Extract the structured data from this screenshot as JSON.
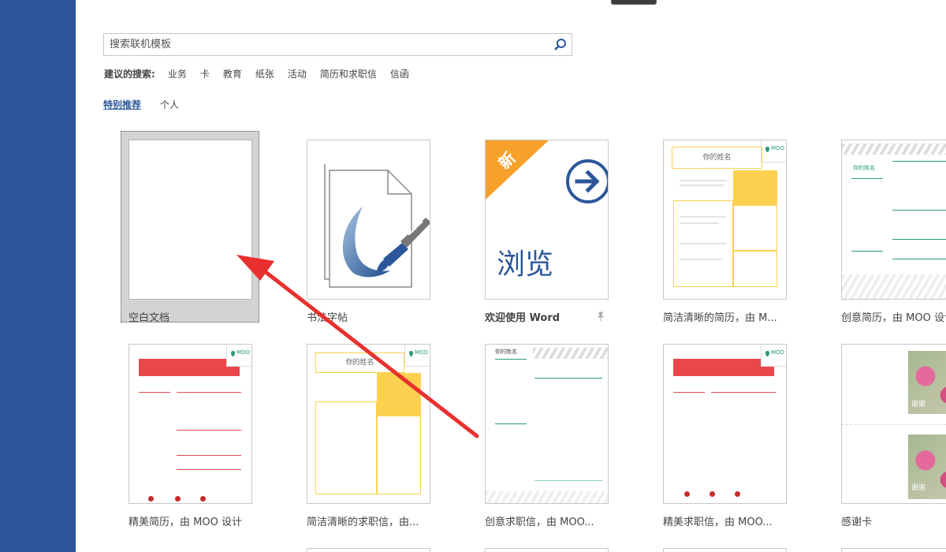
{
  "search": {
    "placeholder": "搜索联机模板"
  },
  "suggested": {
    "label": "建议的搜索:",
    "items": [
      "业务",
      "卡",
      "教育",
      "纸张",
      "活动",
      "简历和求职信",
      "信函"
    ]
  },
  "tabs": [
    {
      "label": "特别推荐",
      "active": true
    },
    {
      "label": "个人",
      "active": false
    }
  ],
  "templates": [
    {
      "label": "空白文档"
    },
    {
      "label": "书法字帖"
    },
    {
      "label": "欢迎使用 Word"
    },
    {
      "label": "简洁清晰的简历，由 M..."
    },
    {
      "label": "创意简历，由 MOO 设计"
    },
    {
      "label": "精美简历，由 MOO 设计"
    },
    {
      "label": "简洁清晰的求职信，由..."
    },
    {
      "label": "创意求职信，由 MOO..."
    },
    {
      "label": "精美求职信，由 MOO..."
    },
    {
      "label": "感谢卡"
    }
  ],
  "browse_tile": {
    "badge": "新",
    "text": "浏览"
  },
  "moo_badge": "MOO",
  "resume_name": "你的姓名",
  "thank_you_text": "谢谢",
  "colors": {
    "sidebar": "#2b579a",
    "accent_red": "#e9474c",
    "accent_yellow": "#fdd150",
    "browse_orange": "#f7a12a",
    "browse_blue": "#2b579a",
    "moo_green": "#2a9d6e",
    "arrow_red": "#e8312f"
  }
}
